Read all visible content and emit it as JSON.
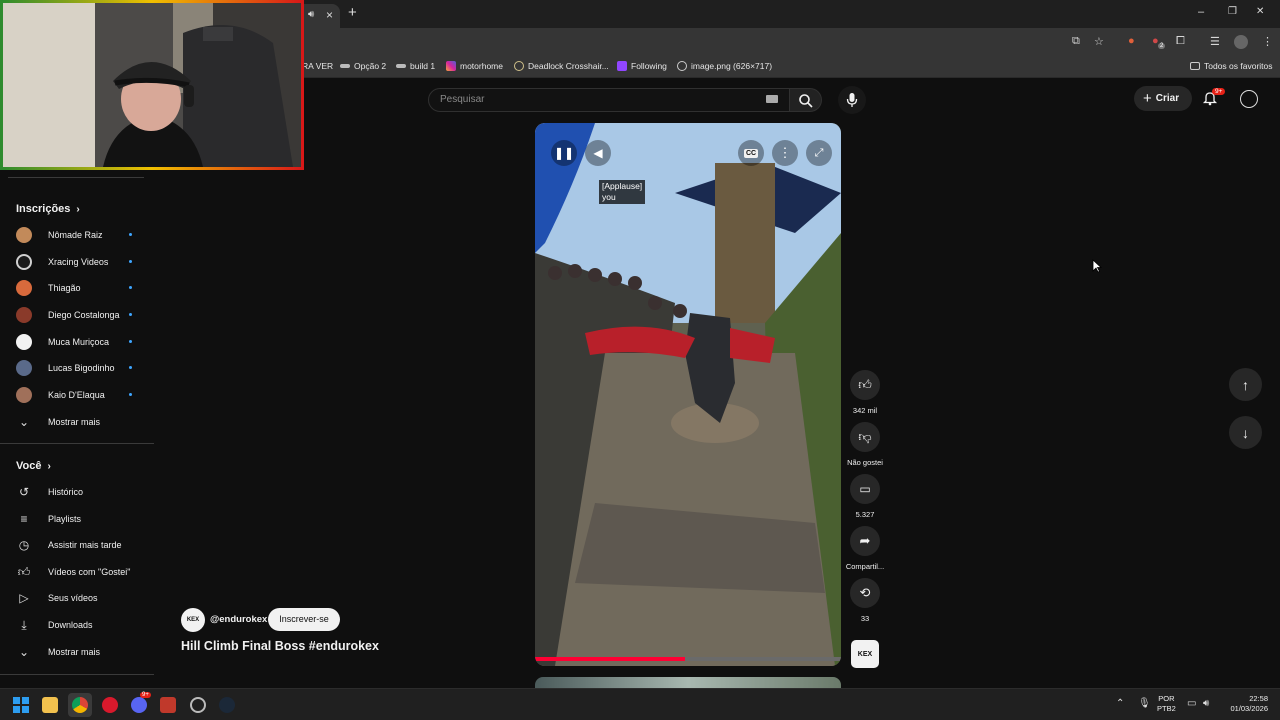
{
  "browser": {
    "tab_close": "×",
    "new_tab": "+",
    "window_controls": [
      "–",
      "❐",
      "✕"
    ],
    "bookmarks": [
      {
        "label": "RA VER",
        "icon": "folder-icon"
      },
      {
        "label": "Opção 2",
        "icon": "link-icon"
      },
      {
        "label": "build 1",
        "icon": "link-icon"
      },
      {
        "label": "motorhome",
        "icon": "instagram-icon"
      },
      {
        "label": "Deadlock Crosshair...",
        "icon": "crosshair-icon"
      },
      {
        "label": "Following",
        "icon": "twitch-icon"
      },
      {
        "label": "image.png (626×717)",
        "icon": "globe-icon"
      }
    ],
    "all_bookmarks": "Todos os favoritos",
    "extension_badge": "2"
  },
  "header": {
    "search_placeholder": "Pesquisar",
    "create_label": "Criar",
    "notification_badge": "9+"
  },
  "sidebar": {
    "subscriptions_title": "Inscrições",
    "subscriptions": [
      {
        "name": "Nômade Raiz",
        "color": "#c28a5a"
      },
      {
        "name": "Xracing Videos",
        "color": "#d0d0d0"
      },
      {
        "name": "Thiagão",
        "color": "#d86a3c"
      },
      {
        "name": "Diego Costalonga",
        "color": "#8a3a2a"
      },
      {
        "name": "Muca Muriçoca",
        "color": "#f2f2f2"
      },
      {
        "name": "Lucas Bigodinho",
        "color": "#5a6a8a"
      },
      {
        "name": "Kaio D'Elaqua",
        "color": "#a0705a"
      }
    ],
    "show_more_1": "Mostrar mais",
    "you_title": "Você",
    "you_items": [
      {
        "label": "Histórico",
        "icon": "history-icon"
      },
      {
        "label": "Playlists",
        "icon": "playlists-icon"
      },
      {
        "label": "Assistir mais tarde",
        "icon": "watch-later-icon"
      },
      {
        "label": "Vídeos com \"Gostei\"",
        "icon": "liked-videos-icon"
      },
      {
        "label": "Seus vídeos",
        "icon": "your-videos-icon"
      },
      {
        "label": "Downloads",
        "icon": "download-icon"
      }
    ],
    "show_more_2": "Mostrar mais"
  },
  "short": {
    "captions": [
      "[Applause]",
      "you"
    ],
    "channel": "@endurokex",
    "subscribe": "Inscrever-se",
    "title": "Hill Climb Final Boss #endurokex",
    "progress": 0.49,
    "actions": {
      "likes": "342 mil",
      "dislike": "Não gostei",
      "comments": "5.327",
      "share": "Compartil...",
      "remix": "33"
    },
    "channel_logo_text": "KEX"
  },
  "taskbar": {
    "lang_top": "POR",
    "lang_bottom": "PTB2",
    "time": "22:58",
    "date": "01/03/2026",
    "discord_badge": "9+"
  }
}
